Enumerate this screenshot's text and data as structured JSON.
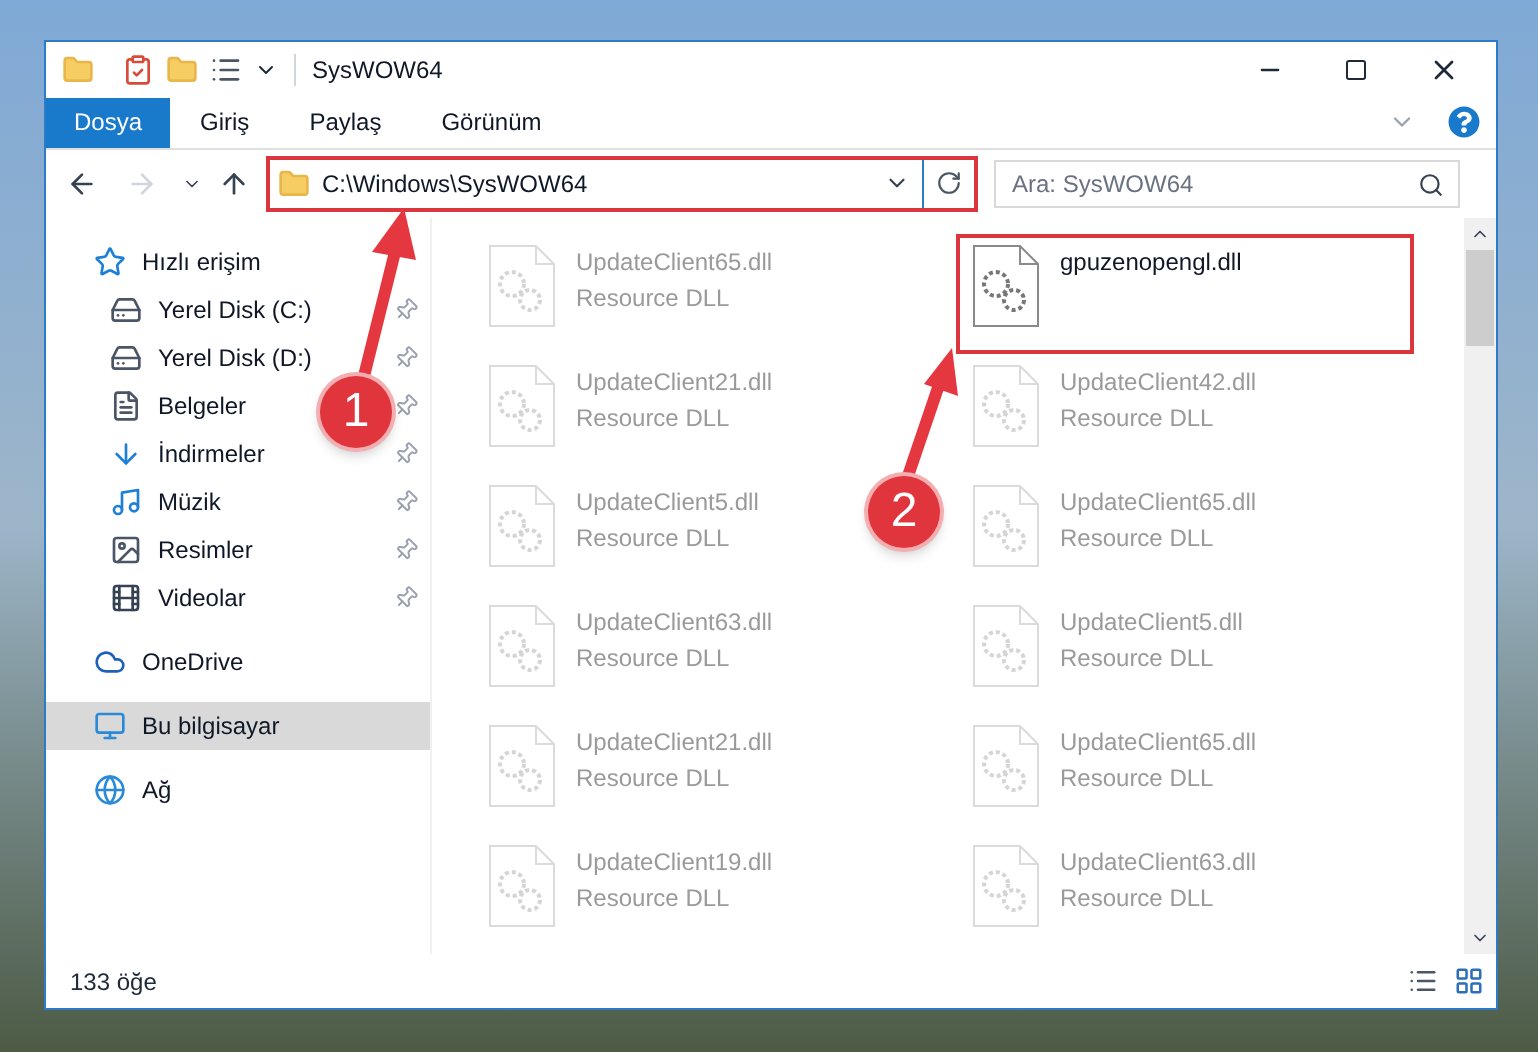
{
  "window": {
    "title": "SysWOW64"
  },
  "ribbon_tabs": [
    {
      "label": "Dosya",
      "kind": "file"
    },
    {
      "label": "Giriş",
      "kind": "tab"
    },
    {
      "label": "Paylaş",
      "kind": "tab"
    },
    {
      "label": "Görünüm",
      "kind": "tab"
    }
  ],
  "address_bar": {
    "path": "C:\\Windows\\SysWOW64",
    "highlighted": true
  },
  "search": {
    "placeholder": "Ara: SysWOW64"
  },
  "sidebar": {
    "items": [
      {
        "label": "Hızlı erişim",
        "kind": "quick",
        "selected": false,
        "children": [
          {
            "label": "Yerel Disk (C:)",
            "kind": "drive",
            "pinned": true,
            "selected": false
          },
          {
            "label": "Yerel Disk (D:)",
            "kind": "drive",
            "pinned": true,
            "selected": false
          },
          {
            "label": "Belgeler",
            "kind": "documents",
            "pinned": true,
            "selected": false
          },
          {
            "label": "İndirmeler",
            "kind": "downloads",
            "pinned": true,
            "selected": false
          },
          {
            "label": "Müzik",
            "kind": "music",
            "pinned": true,
            "selected": false
          },
          {
            "label": "Resimler",
            "kind": "pictures",
            "pinned": true,
            "selected": false
          },
          {
            "label": "Videolar",
            "kind": "videos",
            "pinned": true,
            "selected": false
          }
        ]
      },
      {
        "label": "OneDrive",
        "kind": "cloud",
        "selected": false
      },
      {
        "label": "Bu bilgisayar",
        "kind": "computer",
        "selected": true
      },
      {
        "label": "Ağ",
        "kind": "network",
        "selected": false
      }
    ]
  },
  "files": [
    {
      "name": "UpdateClient65.dll",
      "type": "Resource DLL",
      "faded": true,
      "highlighted": false
    },
    {
      "name": "gpuzenopengl.dll",
      "faded": false,
      "highlighted": true
    },
    {
      "name": "UpdateClient21.dll",
      "type": "Resource DLL",
      "faded": true,
      "highlighted": false
    },
    {
      "name": "UpdateClient42.dll",
      "type": "Resource DLL",
      "faded": true,
      "highlighted": false
    },
    {
      "name": "UpdateClient5.dll",
      "type": "Resource DLL",
      "faded": true,
      "highlighted": false
    },
    {
      "name": "UpdateClient65.dll",
      "type": "Resource DLL",
      "faded": true,
      "highlighted": false
    },
    {
      "name": "UpdateClient63.dll",
      "type": "Resource DLL",
      "faded": true,
      "highlighted": false
    },
    {
      "name": "UpdateClient5.dll",
      "type": "Resource DLL",
      "faded": true,
      "highlighted": false
    },
    {
      "name": "UpdateClient21.dll",
      "type": "Resource DLL",
      "faded": true,
      "highlighted": false
    },
    {
      "name": "UpdateClient65.dll",
      "type": "Resource DLL",
      "faded": true,
      "highlighted": false
    },
    {
      "name": "UpdateClient19.dll",
      "type": "Resource DLL",
      "faded": true,
      "highlighted": false
    },
    {
      "name": "UpdateClient63.dll",
      "type": "Resource DLL",
      "faded": true,
      "highlighted": false
    }
  ],
  "status_bar": {
    "count": "133 öğe"
  },
  "annotations": [
    {
      "number": "1"
    },
    {
      "number": "2"
    }
  ]
}
